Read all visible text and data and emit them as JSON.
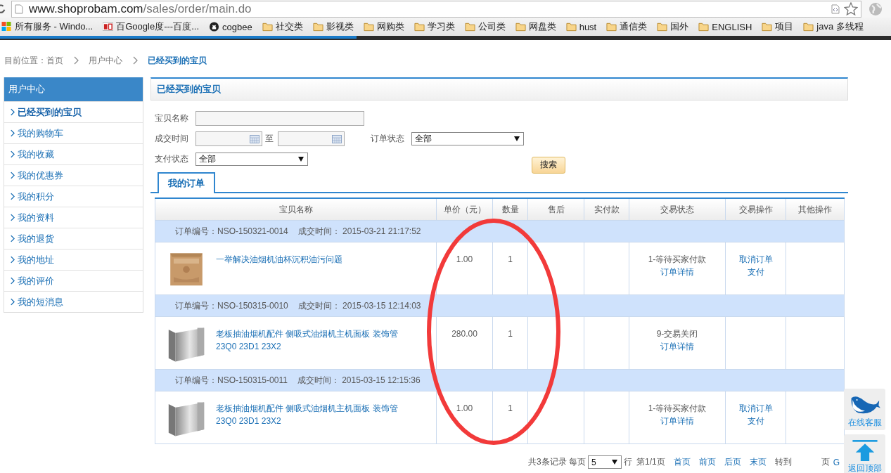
{
  "browser": {
    "url_host": "www.shoprobam.com",
    "url_path": "/sales/order/main.do",
    "bookmarks": [
      {
        "kind": "windows",
        "label": "所有服务 - Windo..."
      },
      {
        "kind": "bc",
        "label": "百Google度---百度..."
      },
      {
        "kind": "github",
        "label": "cogbee"
      },
      {
        "kind": "folder",
        "label": "社交类"
      },
      {
        "kind": "folder",
        "label": "影视类"
      },
      {
        "kind": "folder",
        "label": "网购类"
      },
      {
        "kind": "folder",
        "label": "学习类"
      },
      {
        "kind": "folder",
        "label": "公司类"
      },
      {
        "kind": "folder",
        "label": "网盘类"
      },
      {
        "kind": "folder",
        "label": "hust"
      },
      {
        "kind": "folder",
        "label": "通信类"
      },
      {
        "kind": "folder",
        "label": "国外"
      },
      {
        "kind": "folder",
        "label": "ENGLISH"
      },
      {
        "kind": "folder",
        "label": "项目"
      },
      {
        "kind": "folder",
        "label": "java 多线程"
      }
    ],
    "load_progress": {
      "level": 0.4
    }
  },
  "breadcrumb": [
    "目前位置：首页",
    "用户中心",
    "已经买到的宝贝"
  ],
  "sidebar": {
    "title": "用户中心",
    "items": [
      {
        "label": "已经买到的宝贝",
        "selected": true
      },
      {
        "label": "我的购物车",
        "selected": false
      },
      {
        "label": "我的收藏",
        "selected": false
      },
      {
        "label": "我的优惠券",
        "selected": false
      },
      {
        "label": "我的积分",
        "selected": false
      },
      {
        "label": "我的资料",
        "selected": false
      },
      {
        "label": "我的退货",
        "selected": false
      },
      {
        "label": "我的地址",
        "selected": false
      },
      {
        "label": "我的评价",
        "selected": false
      },
      {
        "label": "我的短消息",
        "selected": false
      }
    ]
  },
  "panel_title": "已经买到的宝贝",
  "filters": {
    "name_label": "宝贝名称",
    "time_label": "成交时间",
    "time_to": "至",
    "order_status_label": "订单状态",
    "order_status": "全部",
    "pay_status_label": "支付状态",
    "pay_status": "全部",
    "search_button": "搜索"
  },
  "tabs": [
    {
      "label": "我的订单",
      "selected": true
    }
  ],
  "table": {
    "columns": [
      "宝贝名称",
      "单价（元）",
      "数量",
      "售后",
      "实付款",
      "交易状态",
      "交易操作",
      "其他操作"
    ],
    "orders": [
      {
        "order_no": "订单编号：NSO-150321-0014",
        "time": "成交时间： 2015-03-21 21:17:52",
        "name": [
          "一举解决油烟机油杯沉积油污问题"
        ],
        "price": "1.00",
        "qty": "1",
        "status": "1-等待买家付款",
        "detail": "订单详情",
        "actions": [
          "取消订单",
          "支付"
        ]
      },
      {
        "order_no": "订单编号：NSO-150315-0010",
        "time": "成交时间： 2015-03-15 12:14:03",
        "name": [
          "老板抽油烟机配件 侧吸式油烟机主机面板 装饰管",
          "23Q0 23D1 23X2"
        ],
        "price": "280.00",
        "qty": "1",
        "status": "9-交易关闭",
        "detail": "订单详情"
      },
      {
        "order_no": "订单编号：NSO-150315-0011",
        "time": "成交时间： 2015-03-15 12:15:36",
        "name": [
          "老板抽油烟机配件 侧吸式油烟机主机面板 装饰管",
          "23Q0 23D1 23X2"
        ],
        "price": "1.00",
        "qty": "1",
        "status": "1-等待买家付款",
        "detail": "订单详情",
        "actions": [
          "取消订单",
          "支付"
        ]
      }
    ]
  },
  "pagination": {
    "summary": "共3条记录 每页",
    "page_size": "5",
    "rows_unit": "行",
    "page_info": "第1/1页",
    "links": [
      "首页",
      "前页",
      "后页",
      "末页"
    ],
    "goto": "转到",
    "page_unit": "页",
    "go": "G"
  },
  "float_buttons": [
    {
      "kind": "service",
      "label": "在线客服"
    },
    {
      "kind": "top",
      "label": "返回顶部"
    }
  ]
}
